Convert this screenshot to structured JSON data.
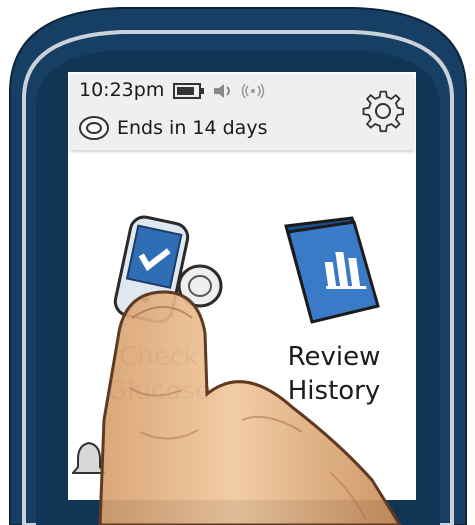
{
  "status_bar": {
    "time": "10:23pm",
    "sensor_text": "Ends in 14 days"
  },
  "tiles": [
    {
      "line1": "Check",
      "line2": "Glucose"
    },
    {
      "line1": "Review",
      "line2": "History"
    }
  ],
  "colors": {
    "device_body": "#173f64",
    "device_rim": "#b9c2cc",
    "screen": "#ffffff",
    "accent_blue": "#2f6db5",
    "skin": "#e8b98a"
  },
  "icons": [
    "battery-icon",
    "speaker-icon",
    "signal-icon",
    "sensor-icon",
    "gear-icon",
    "check-glucose-icon",
    "review-history-icon",
    "bell-icon"
  ]
}
